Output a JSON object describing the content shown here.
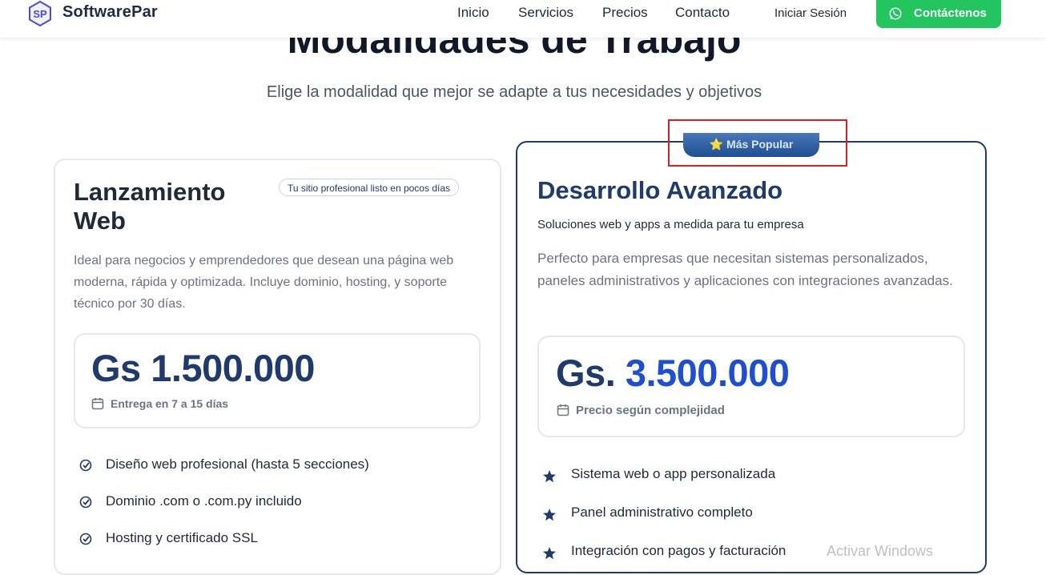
{
  "header": {
    "brand": "SoftwarePar",
    "nav": [
      "Inicio",
      "Servicios",
      "Precios",
      "Contacto"
    ],
    "login_label": "Iniciar Sesión",
    "contact_button": "Contáctenos",
    "accent": "#22c55e"
  },
  "hero": {
    "title": "Modalidades de Trabajo",
    "subtitle": "Elige la modalidad que mejor se adapte a tus necesidades y objetivos"
  },
  "plans": [
    {
      "title": "Lanzamiento Web",
      "tag": "Tu sitio profesional listo en pocos días",
      "description": "Ideal para negocios y emprendedores que desean una página web moderna, rápida y optimizada. Incluye dominio, hosting, y soporte técnico por 30 días.",
      "price_prefix": "Gs",
      "price_value": "1.500.000",
      "price_note": "Entrega en 7 a 15 días",
      "features": [
        "Diseño web profesional (hasta 5 secciones)",
        "Dominio .com o .com.py incluido",
        "Hosting y certificado SSL"
      ],
      "feature_icon": "check-circle-icon"
    },
    {
      "badge": "⭐ Más Popular",
      "title": "Desarrollo Avanzado",
      "subtitle": "Soluciones web y apps a medida para tu empresa",
      "description": "Perfecto para empresas que necesitan sistemas personalizados, paneles administrativos y aplicaciones con integraciones avanzadas.",
      "price_prefix": "Gs.",
      "price_value": "3.500.000",
      "price_note": "Precio según complejidad",
      "features": [
        "Sistema web o app personalizada",
        "Panel administrativo completo",
        "Integración con pagos y facturación"
      ],
      "feature_icon": "star-icon"
    }
  ],
  "watermark": "Activar Windows",
  "colors": {
    "navy": "#1e3a6e",
    "blue": "#1d4ed8",
    "highlight": "#e11d1d"
  }
}
